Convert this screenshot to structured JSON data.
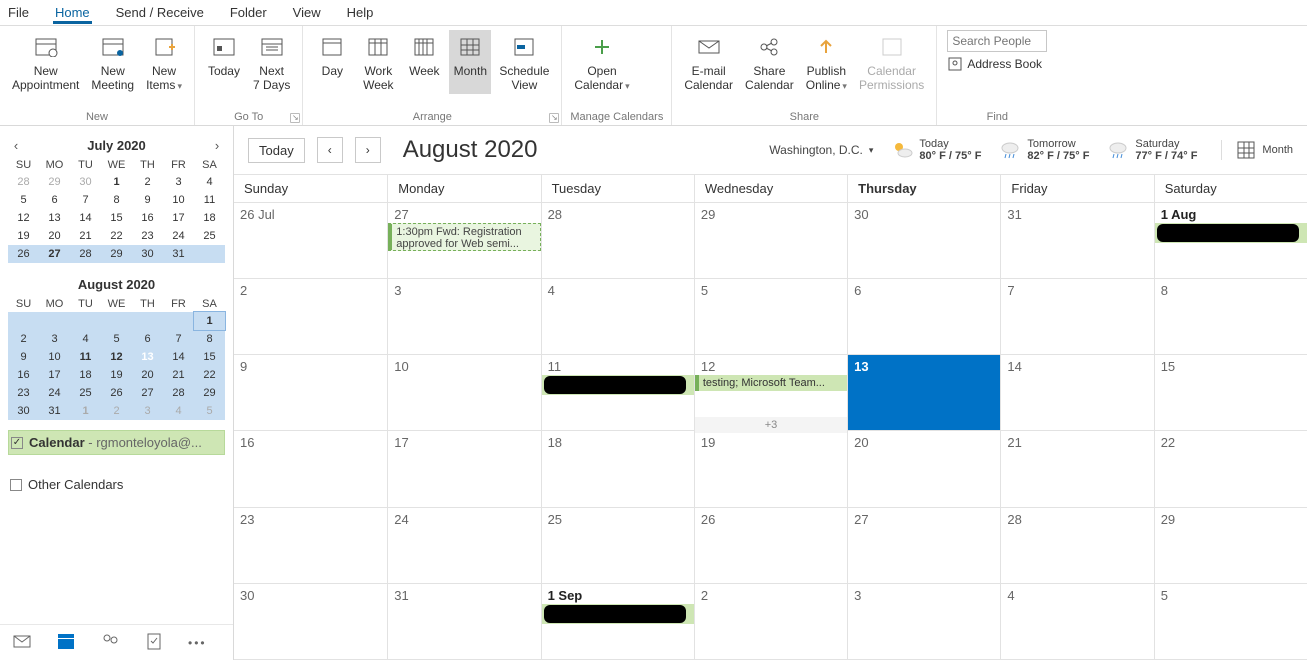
{
  "menu": {
    "file": "File",
    "home": "Home",
    "sendreceive": "Send / Receive",
    "folder": "Folder",
    "view": "View",
    "help": "Help"
  },
  "ribbon": {
    "new": {
      "label": "New",
      "appointment": "New\nAppointment",
      "meeting": "New\nMeeting",
      "items": "New\nItems"
    },
    "goto": {
      "label": "Go To",
      "today": "Today",
      "next7": "Next\n7 Days"
    },
    "arrange": {
      "label": "Arrange",
      "day": "Day",
      "workweek": "Work\nWeek",
      "week": "Week",
      "month": "Month",
      "schedule": "Schedule\nView"
    },
    "manage": {
      "label": "Manage Calendars",
      "open": "Open\nCalendar"
    },
    "share": {
      "label": "Share",
      "email": "E-mail\nCalendar",
      "sharecal": "Share\nCalendar",
      "publish": "Publish\nOnline",
      "perm": "Calendar\nPermissions"
    },
    "find": {
      "label": "Find",
      "search_ph": "Search People",
      "addr": "Address Book"
    }
  },
  "mini": {
    "prev_label": "July 2020",
    "next_label": "August 2020",
    "dow": [
      "SU",
      "MO",
      "TU",
      "WE",
      "TH",
      "FR",
      "SA"
    ],
    "july": [
      [
        "28",
        "29",
        "30",
        "1",
        "2",
        "3",
        "4"
      ],
      [
        "5",
        "6",
        "7",
        "8",
        "9",
        "10",
        "11"
      ],
      [
        "12",
        "13",
        "14",
        "15",
        "16",
        "17",
        "18"
      ],
      [
        "19",
        "20",
        "21",
        "22",
        "23",
        "24",
        "25"
      ],
      [
        "26",
        "27",
        "28",
        "29",
        "30",
        "31",
        ""
      ]
    ],
    "august": [
      [
        "",
        "",
        "",
        "",
        "",
        "",
        "1"
      ],
      [
        "2",
        "3",
        "4",
        "5",
        "6",
        "7",
        "8"
      ],
      [
        "9",
        "10",
        "11",
        "12",
        "13",
        "14",
        "15"
      ],
      [
        "16",
        "17",
        "18",
        "19",
        "20",
        "21",
        "22"
      ],
      [
        "23",
        "24",
        "25",
        "26",
        "27",
        "28",
        "29"
      ],
      [
        "30",
        "31",
        "1",
        "2",
        "3",
        "4",
        "5"
      ]
    ]
  },
  "calendars": {
    "mycal": "Calendar",
    "mycal_account": " - rgmonteloyola@...",
    "other": "Other Calendars"
  },
  "header": {
    "today_btn": "Today",
    "title": "August 2020",
    "location": "Washington,  D.C.",
    "w1": {
      "lbl": "Today",
      "temp": "80° F / 75° F"
    },
    "w2": {
      "lbl": "Tomorrow",
      "temp": "82° F / 75° F"
    },
    "w3": {
      "lbl": "Saturday",
      "temp": "77° F / 74° F"
    },
    "view": "Month"
  },
  "dow": [
    "Sunday",
    "Monday",
    "Tuesday",
    "Wednesday",
    "Thursday",
    "Friday",
    "Saturday"
  ],
  "cells": [
    "26 Jul",
    "27",
    "28",
    "29",
    "30",
    "31",
    "1 Aug",
    "2",
    "3",
    "4",
    "5",
    "6",
    "7",
    "8",
    "9",
    "10",
    "11",
    "12",
    "13",
    "14",
    "15",
    "16",
    "17",
    "18",
    "19",
    "20",
    "21",
    "22",
    "23",
    "24",
    "25",
    "26",
    "27",
    "28",
    "29",
    "30",
    "31",
    "1 Sep",
    "2",
    "3",
    "4",
    "5"
  ],
  "events": {
    "reg": "1:30pm Fwd: Registration approved for Web semi...",
    "testing": "testing; Microsoft Team...",
    "more": "+3",
    "redact": "████████"
  }
}
